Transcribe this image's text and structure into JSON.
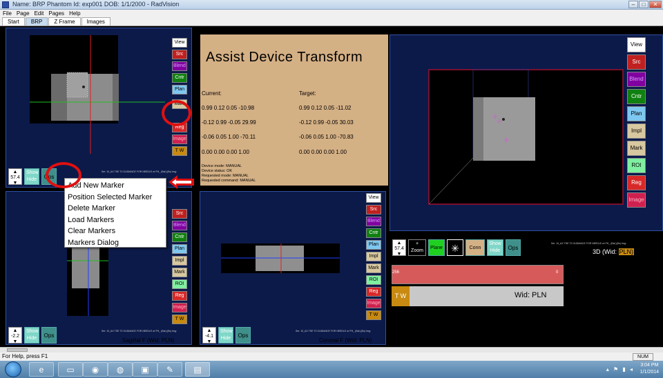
{
  "window": {
    "title": "Name: BRP Phantom   Id: exp001   DOB: 1/1/2000 - RadVision"
  },
  "menubar": [
    "File",
    "Page",
    "Edit",
    "Pages",
    "Help"
  ],
  "tabs": [
    {
      "label": "Start",
      "active": false
    },
    {
      "label": "BRP",
      "active": true
    },
    {
      "label": "Z Frame",
      "active": false
    },
    {
      "label": "Images",
      "active": false
    }
  ],
  "side_buttons": {
    "view": "View",
    "src": "Src",
    "blend": "Blend",
    "cntr": "Cntr",
    "plan": "Plan",
    "mark": "Mark",
    "impl": "Impl",
    "roi": "ROI",
    "reg": "Reg",
    "image": "Image",
    "tw": "T W"
  },
  "panels": {
    "axial": {
      "spin_value": "57.4",
      "show_hide": "Show\nHide",
      "ops": "Ops",
      "caption": "Ser. 10_AX TSE T2 GUIDANCE FOR NEEDLE w/ FH_ (Bal.)(Ss) Img:"
    },
    "sagittal": {
      "spin_value": "-2.2",
      "show_hide": "Show\nHide",
      "ops": "Ops",
      "caption": "Ser. 10_AX TSE T2 GUIDANCE FOR NEEDLE w/ FH_ (Bal.)(Ss) Img:",
      "title": "Sagittal F (Wid: PLN)"
    },
    "coronal": {
      "spin_value": "-4.1",
      "show_hide": "Show\nHide",
      "ops": "Ops",
      "caption": "Ser. 10_AX TSE T2 GUIDANCE FOR NEEDLE w/ FH_ (Bal.)(Ss) Img:",
      "title": "Coronal F (Wid: PLN)"
    },
    "threed": {
      "spin_value": "57.4",
      "zoom": "Zoom",
      "plane": "Plane",
      "conn": "Conn",
      "show_hide": "Show\nHide",
      "ops": "Ops",
      "caption": "Ser. 10_AX TSE T2 GUIDANCE FOR NEEDLE w/ FH_ (Bal.)(Ss) Img:",
      "title": "3D (Wid:",
      "title_badge": "PLN)"
    }
  },
  "assist": {
    "title": "Assist Device Transform",
    "current_label": "Current:",
    "target_label": "Target:",
    "current_rows": [
      "0.99  0.12  0.05  -10.98",
      "-0.12  0.99  -0.05  29.99",
      "-0.06  0.05  1.00  -70.11",
      "0.00  0.00  0.00  1.00"
    ],
    "target_rows": [
      "0.99  0.12  0.05  -11.02",
      "-0.12  0.99  -0.05  30.03",
      "-0.06  0.05  1.00  -70.83",
      "0.00  0.00  0.00  1.00"
    ],
    "status_lines": [
      "Device mode: MANUAL",
      "Device status: OK",
      "Requested mode: MANUAL",
      "Requested command: MANUAL"
    ]
  },
  "context_menu": {
    "items": [
      "Add New Marker",
      "Position Selected Marker",
      "Delete Marker",
      "Load Markers",
      "Clear Markers",
      "Markers Dialog"
    ]
  },
  "window_level": {
    "low": "256",
    "high": "0",
    "tw": "T W",
    "wid": "Wid: PLN"
  },
  "statusbar": {
    "help": "For Help, press F1",
    "num": "NUM"
  },
  "taskbar": {
    "time": "3:04 PM",
    "date": "1/1/2014"
  },
  "colors": {
    "assist_bg": "#d4b085",
    "highlight_red": "#e01010",
    "panel_navy": "#0c1a4a"
  }
}
